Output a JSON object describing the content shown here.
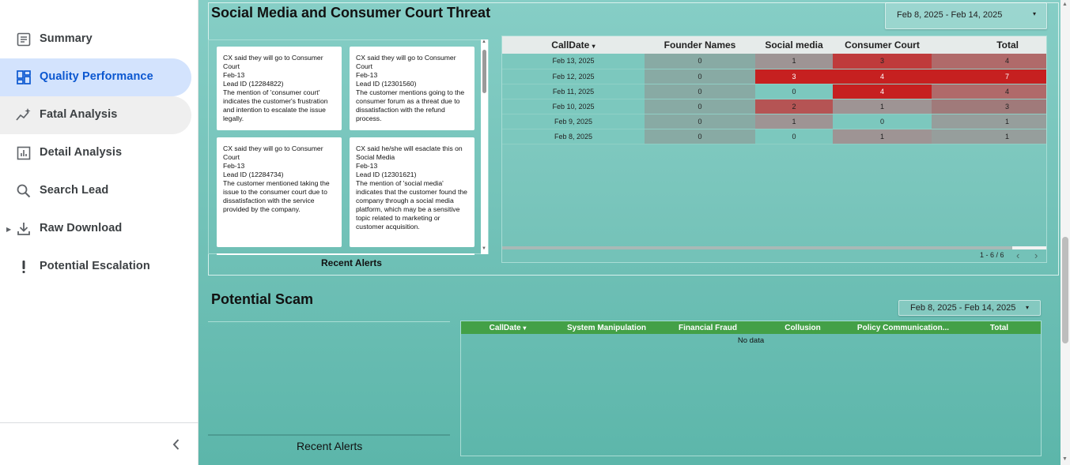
{
  "sidebar": {
    "items": [
      {
        "label": "Summary",
        "icon": "summary-icon"
      },
      {
        "label": "Quality Performance",
        "icon": "dashboard-icon"
      },
      {
        "label": "Fatal Analysis",
        "icon": "sparkle-trend-icon"
      },
      {
        "label": "Detail Analysis",
        "icon": "bar-chart-icon"
      },
      {
        "label": "Search Lead",
        "icon": "search-icon"
      },
      {
        "label": "Raw Download",
        "icon": "download-icon"
      },
      {
        "label": "Potential Escalation",
        "icon": "exclamation-icon"
      }
    ],
    "active_index": 1,
    "colors": {
      "active_bg": "#d3e3fd",
      "active_fg": "#0b57d0"
    }
  },
  "section1": {
    "title": "Social Media and Consumer Court Threat",
    "date_range": "Feb 8, 2025 - Feb 14, 2025",
    "alerts_caption": "Recent Alerts",
    "cards": [
      {
        "lines": [
          "CX said they will go to Consumer Court",
          "Feb-13",
          "Lead ID (12284822)",
          "The mention of 'consumer court' indicates the customer's frustration and intention to escalate the issue legally."
        ]
      },
      {
        "lines": [
          "CX said they will go to Consumer Court",
          "Feb-13",
          "Lead ID (12301560)",
          "The customer mentions going to the consumer forum as a threat due to dissatisfaction with the refund process."
        ]
      },
      {
        "lines": [
          "CX said they will go to Consumer Court",
          "Feb-13",
          "Lead ID (12284734)",
          "The customer mentioned taking the issue to the consumer court due to dissatisfaction with the service provided by the company."
        ]
      },
      {
        "lines": [
          "CX said he/she will esaclate this on Social Media",
          "Feb-13",
          "Lead ID (12301621)",
          "The mention of 'social media' indicates that the customer found the company through a social media platform, which may be a sensitive topic related to marketing or customer acquisition."
        ]
      }
    ],
    "table": {
      "headers": [
        "CallDate",
        "Founder Names",
        "Social media",
        "Consumer Court",
        "Total"
      ],
      "sort_indicator": "▾",
      "rows": [
        [
          "Feb 13, 2025",
          "0",
          "1",
          "3",
          "4"
        ],
        [
          "Feb 12, 2025",
          "0",
          "3",
          "4",
          "7"
        ],
        [
          "Feb 11, 2025",
          "0",
          "0",
          "4",
          "4"
        ],
        [
          "Feb 10, 2025",
          "0",
          "2",
          "1",
          "3"
        ],
        [
          "Feb 9, 2025",
          "0",
          "1",
          "0",
          "1"
        ],
        [
          "Feb 8, 2025",
          "0",
          "0",
          "1",
          "1"
        ]
      ],
      "pagination": "1 - 6 / 6"
    }
  },
  "section2": {
    "title": "Potential Scam",
    "date_range": "Feb 8, 2025 - Feb 14, 2025",
    "alerts_caption": "Recent Alerts",
    "table": {
      "headers": [
        "CallDate",
        "System Manipulation",
        "Financial Fraud",
        "Collusion",
        "Policy Communication...",
        "Total"
      ],
      "empty_text": "No data"
    }
  }
}
